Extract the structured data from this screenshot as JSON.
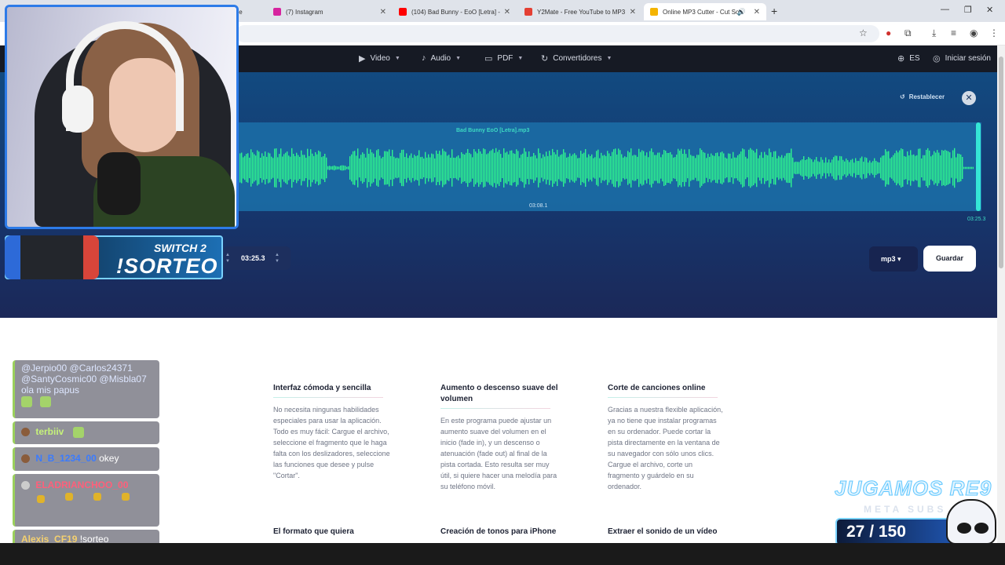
{
  "browser": {
    "tabs": [
      {
        "title": "gle",
        "color": "#4285f4"
      },
      {
        "title": "(7) Instagram",
        "color": "#d6249f"
      },
      {
        "title": "(104) Bad Bunny - EoO [Letra] -",
        "color": "#ff0000"
      },
      {
        "title": "Y2Mate - Free YouTube to MP3",
        "color": "#e43f33"
      },
      {
        "title": "Online MP3 Cutter - Cut So",
        "color": "#f4b400"
      }
    ],
    "new_tab": "+",
    "window_controls": {
      "minimize": "—",
      "restore": "❐",
      "close": "✕"
    }
  },
  "nav": {
    "video": "Video",
    "audio": "Audio",
    "pdf": "PDF",
    "converters": "Convertidores",
    "language": "ES",
    "login": "Iniciar sesión"
  },
  "editor": {
    "reset": "Restablecer",
    "filename": "Bad Bunny EoO [Letra].mp3",
    "current_time": "03:08.1",
    "end_time": "03:25.3",
    "end_input": "03:25.3",
    "format": "mp3 ▾",
    "save": "Guardar",
    "wave_color": "#2ef58f"
  },
  "features": [
    {
      "title": "Interfaz cómoda y sencilla",
      "body": "No necesita ningunas habilidades especiales para usar la aplicación. Todo es muy fácil: Cargue el archivo, seleccione el fragmento que le haga falta con los deslizadores, seleccione las funciones que desee y pulse \"Cortar\"."
    },
    {
      "title": "Aumento o descenso suave del volumen",
      "body": "En este programa puede ajustar un aumento suave del volumen en el inicio (fade in), y un descenso o atenuación (fade out) al final de la pista cortada. Esto resulta ser muy útil, si quiere hacer una melodía para su teléfono móvil."
    },
    {
      "title": "Corte de canciones online",
      "body": "Gracias a nuestra flexible aplicación, ya no tiene que instalar programas en su ordenador. Puede cortar la pista directamente en la ventana de su navegador con sólo unos clics. Cargue el archivo, corte un fragmento y guárdelo en su ordenador."
    },
    {
      "title": "El formato que quiera",
      "body": ""
    },
    {
      "title": "Creación de tonos para iPhone",
      "body": ""
    },
    {
      "title": "Extraer el sonido de un vídeo",
      "body": ""
    }
  ],
  "overlay": {
    "sorteo_line1": "SWITCH 2",
    "sorteo_line2": "!SORTEO",
    "chat": [
      {
        "user": "",
        "text": "@Jerpio00 @Carlos24371 @SantyCosmic00 @Misbla07 ola mis papus",
        "user_color": "#ffffff"
      },
      {
        "user": "terbiiv",
        "text": "",
        "user_color": "#c6f27a"
      },
      {
        "user": "N_B_1234_00",
        "text": "okey",
        "user_color": "#3a7bff"
      },
      {
        "user": "ELADRIANCHOO_00",
        "text": "",
        "user_color": "#ff5f7a"
      },
      {
        "user": "Alexis_CF19",
        "text": "!sorteo",
        "user_color": "#f4d06f"
      }
    ],
    "banner": "JUGAMOS RE9",
    "banner_sub": "META SUBS",
    "counter": "27 / 150"
  }
}
